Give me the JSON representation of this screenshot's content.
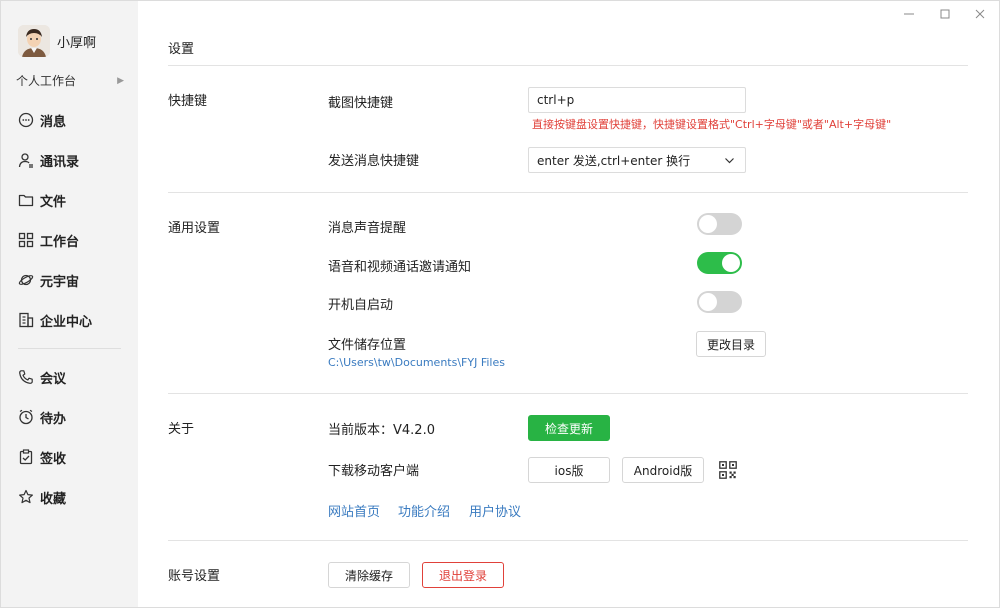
{
  "user": {
    "name": "小厚啊"
  },
  "sidebar": {
    "workspace": "个人工作台",
    "items": [
      {
        "label": "消息",
        "icon": "chat-bubble-icon"
      },
      {
        "label": "通讯录",
        "icon": "contacts-icon"
      },
      {
        "label": "文件",
        "icon": "folder-icon"
      },
      {
        "label": "工作台",
        "icon": "grid-icon"
      },
      {
        "label": "元宇宙",
        "icon": "planet-icon"
      },
      {
        "label": "企业中心",
        "icon": "building-icon"
      },
      {
        "label": "会议",
        "icon": "phone-icon"
      },
      {
        "label": "待办",
        "icon": "clock-icon"
      },
      {
        "label": "签收",
        "icon": "clipboard-check-icon"
      },
      {
        "label": "收藏",
        "icon": "star-icon"
      }
    ]
  },
  "settings": {
    "title": "设置",
    "shortcuts": {
      "section": "快捷键",
      "screenshot_label": "截图快捷键",
      "screenshot_value": "ctrl+p",
      "hint": "直接按键盘设置快捷键，快捷键设置格式\"Ctrl+字母键\"或者\"Alt+字母键\"",
      "send_label": "发送消息快捷键",
      "send_value": "enter 发送,ctrl+enter 换行"
    },
    "general": {
      "section": "通用设置",
      "sound_label": "消息声音提醒",
      "sound_on": false,
      "call_label": "语音和视频通话邀请通知",
      "call_on": true,
      "autostart_label": "开机自启动",
      "autostart_on": false,
      "storage_label": "文件储存位置",
      "storage_path": "C:\\Users\\tw\\Documents\\FYJ Files",
      "change_dir": "更改目录"
    },
    "about": {
      "section": "关于",
      "version_label": "当前版本：V4.2.0",
      "check_update": "检查更新",
      "download_label": "下载移动客户端",
      "ios": "ios版",
      "android": "Android版",
      "links": [
        "网站首页",
        "功能介绍",
        "用户协议"
      ]
    },
    "account": {
      "section": "账号设置",
      "clear_cache": "清除缓存",
      "logout": "退出登录"
    }
  },
  "colors": {
    "accent_green": "#2dbd4a",
    "danger": "#e0413a",
    "link": "#3a7bc0"
  }
}
